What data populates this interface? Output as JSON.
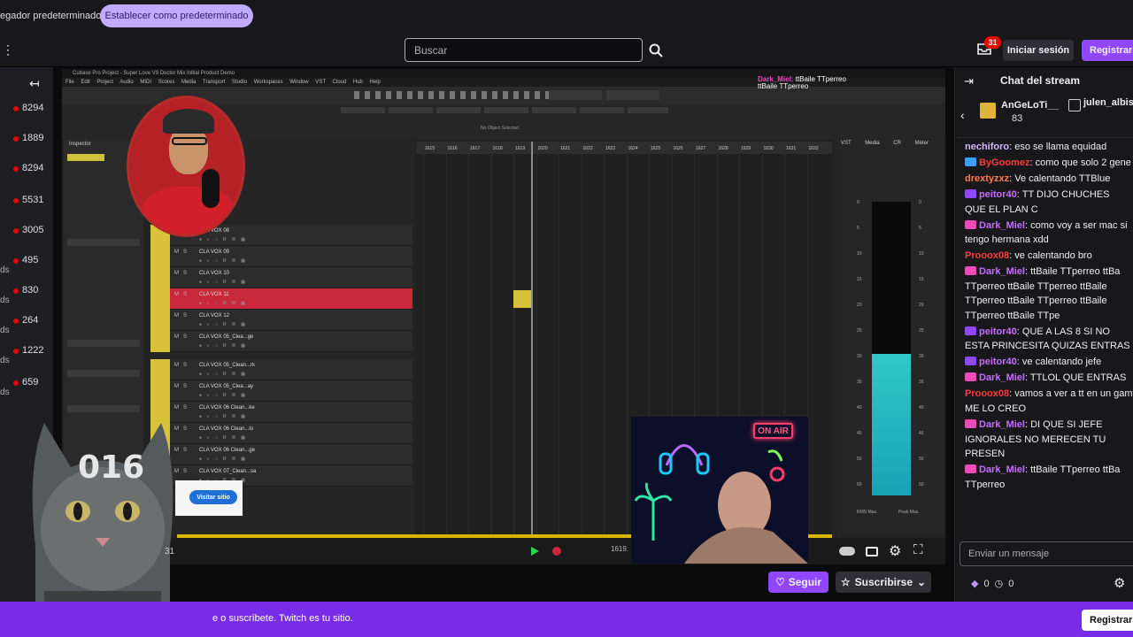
{
  "browser_bar": {
    "text": "egador predeterminado",
    "button": "Establecer como predeterminado"
  },
  "header": {
    "search_placeholder": "Buscar",
    "notifications_count": "31",
    "login": "Iniciar sesión",
    "register": "Registrarse"
  },
  "sidebar": {
    "items": [
      {
        "count": "8294",
        "ds": ""
      },
      {
        "count": "1889",
        "ds": ""
      },
      {
        "count": "8294",
        "ds": ""
      },
      {
        "count": "5531",
        "ds": ""
      },
      {
        "count": "3005",
        "ds": ""
      },
      {
        "count": "495",
        "ds": "ds"
      },
      {
        "count": "830",
        "ds": "ds"
      },
      {
        "count": "264",
        "ds": "ds"
      },
      {
        "count": "1222",
        "ds": "ds"
      },
      {
        "count": "659",
        "ds": "ds"
      }
    ]
  },
  "cubase": {
    "title": "Cubase Pro Project - Super Love V9 Doctor Mix Initial Product Demo",
    "menu": "File Edit Project Audio MIDI Scores Media Transport Studio Workspaces Window VST Cloud Hub Help",
    "no_object": "No Object Selected",
    "inspector": "Inspector",
    "tracks": [
      {
        "name": "CLA VOX 08",
        "selected": false
      },
      {
        "name": "CLA VOX 09",
        "selected": false
      },
      {
        "name": "CLA VOX 10",
        "selected": false
      },
      {
        "name": "CLA VOX 11",
        "selected": true
      },
      {
        "name": "CLA VOX 12",
        "selected": false
      },
      {
        "name": "CLA VOX 05_Clea...ge",
        "selected": false
      },
      {
        "name": "CLA VOX 05_Clean...rk",
        "selected": false
      },
      {
        "name": "CLA VOX 05_Clea...ay",
        "selected": false
      },
      {
        "name": "CLA VOX 06 Clean...ke",
        "selected": false
      },
      {
        "name": "CLA VOX 06 Clean...lo",
        "selected": false
      },
      {
        "name": "CLA VOX 06 Clean...ge",
        "selected": false
      },
      {
        "name": "CLA VOX 07_Clean...sa",
        "selected": false
      }
    ],
    "bars": [
      "1615",
      "1616",
      "1617",
      "1618",
      "1619",
      "1620",
      "1621",
      "1622",
      "1623",
      "1624",
      "1625",
      "1626",
      "1627",
      "1628",
      "1629",
      "1630",
      "1631",
      "1632"
    ],
    "meter_tabs": "VST Media CR Meter",
    "meter_scale": [
      "0",
      "5",
      "10",
      "15",
      "20",
      "25",
      "30",
      "35",
      "40",
      "45",
      "50",
      "60"
    ],
    "meter_labels": {
      "rms": "RMS Max.",
      "peak": "Peak Max."
    },
    "transport_pos": "1619."
  },
  "overlay": {
    "chat_user": "Dark_Miel:",
    "chat_text": "ttBaile TTperreo",
    "chat_line2": "ttBaile TTperreo",
    "on_air": "ON AIR",
    "cat_number": "016",
    "visit_site": "Visitar sitio",
    "page_num": "31"
  },
  "player": {
    "follow": "Seguir",
    "subscribe": "Suscribirse"
  },
  "bottom_banner": {
    "text": "e o suscríbete. Twitch es tu sitio.",
    "register": "Registrarse"
  },
  "chat": {
    "title": "Chat del stream",
    "gift_user": "AnGeLoTi__",
    "gift_count": "83",
    "gift_user2": "julen_albisu",
    "messages": [
      {
        "user": "nechiforo",
        "color": "#d8b4fe",
        "badge": "",
        "text": "eso se llama equidad"
      },
      {
        "user": "ByGoomez",
        "color": "#ff3b3b",
        "badge": "#3aa0ff",
        "text": "como que solo 2 gene"
      },
      {
        "user": "drextyzxz",
        "color": "#ff7b4f",
        "badge": "",
        "text": "Ve calentando TTBlue"
      },
      {
        "user": "peitor40",
        "color": "#c56dff",
        "badge": "#9147ff",
        "text": "TT DIJO CHUCHES QUE EL PLAN C"
      },
      {
        "user": "Dark_Miel",
        "color": "#c56dff",
        "badge": "#e94bb8",
        "text": "como voy a ser mac si tengo hermana xdd"
      },
      {
        "user": "Prooox08",
        "color": "#ff3b3b",
        "badge": "",
        "text": "ve calentando bro"
      },
      {
        "user": "Dark_Miel",
        "color": "#c56dff",
        "badge": "#e94bb8",
        "text": "ttBaile TTperreo ttBa TTperreo ttBaile TTperreo ttBaile TTperreo ttBaile TTperreo ttBaile TTperreo ttBaile TTpe"
      },
      {
        "user": "peitor40",
        "color": "#c56dff",
        "badge": "#9147ff",
        "text": "QUE A LAS 8 SI NO ESTA PRINCESITA QUIZAS ENTRAS"
      },
      {
        "user": "peitor40",
        "color": "#c56dff",
        "badge": "#9147ff",
        "text": "ve calentando jefe"
      },
      {
        "user": "Dark_Miel",
        "color": "#c56dff",
        "badge": "#e94bb8",
        "text": "TTLOL QUE ENTRAS"
      },
      {
        "user": "Prooox08",
        "color": "#ff3b3b",
        "badge": "",
        "text": "vamos a ver a tt en un gam ME LO CREO"
      },
      {
        "user": "Dark_Miel",
        "color": "#c56dff",
        "badge": "#e94bb8",
        "text": "DI QUE SI JEFE IGNORALES NO MERECEN TU PRESEN"
      },
      {
        "user": "Dark_Miel",
        "color": "#c56dff",
        "badge": "#e94bb8",
        "text": "ttBaile TTperreo ttBa TTperreo"
      }
    ],
    "input_placeholder": "Enviar un mensaje",
    "points_a": "0",
    "points_b": "0"
  },
  "colors": {
    "accent": "#9147ff",
    "banner": "#772ce8",
    "live": "#eb0400"
  }
}
